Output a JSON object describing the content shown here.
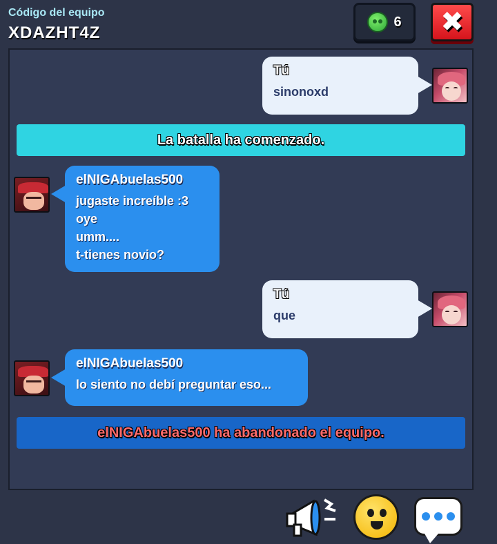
{
  "header": {
    "label": "Código del equipo",
    "code": "XDAZHT4Z",
    "online_count": "6",
    "close_symbol": "✖"
  },
  "messages": [
    {
      "author": "Tú",
      "lines": [
        "sinonoxd"
      ]
    },
    {
      "author": "elNIGAbuelas500",
      "lines": [
        "jugaste increíble :3",
        "oye",
        "umm....",
        "t-tienes novio?"
      ]
    },
    {
      "author": "Tú",
      "lines": [
        "que"
      ]
    },
    {
      "author": "elNIGAbuelas500",
      "lines": [
        "lo siento no debí preguntar eso..."
      ]
    }
  ],
  "system": {
    "battle_started": "La batalla ha comenzado.",
    "player_left": "elNIGAbuelas500 ha abandonado el equipo."
  },
  "toolbar": {
    "icons": [
      "megaphone-icon",
      "emote-icon",
      "chat-icon"
    ]
  },
  "colors": {
    "background": "#2d3448",
    "own_bubble": "#e9f1fb",
    "other_bubble": "#2b8fee",
    "battle_banner": "#2fd4e2",
    "left_banner": "#1866c8",
    "left_text": "#ff6b6b",
    "close_button": "#d5141c"
  }
}
